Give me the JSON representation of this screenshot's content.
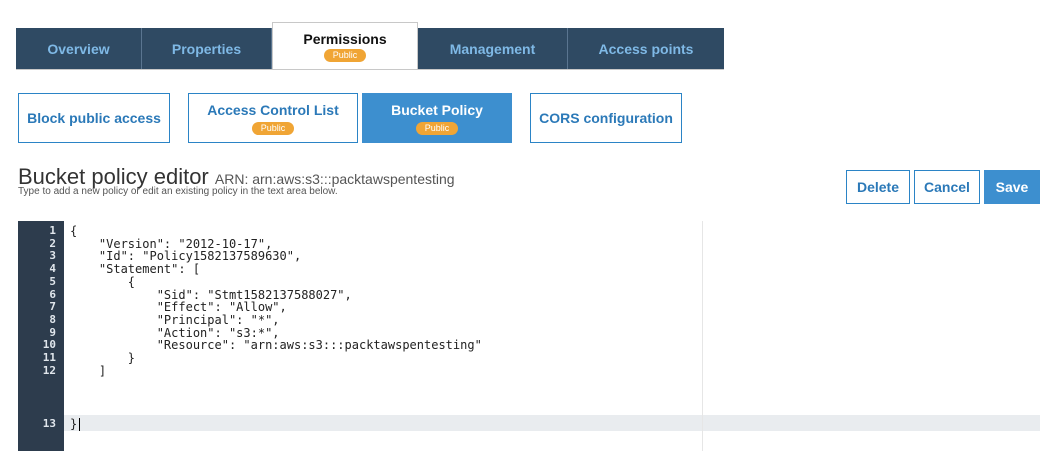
{
  "tabs": [
    {
      "label": "Overview",
      "badge": ""
    },
    {
      "label": "Properties",
      "badge": ""
    },
    {
      "label": "Permissions",
      "badge": "Public",
      "active": true
    },
    {
      "label": "Management",
      "badge": ""
    },
    {
      "label": "Access points",
      "badge": ""
    }
  ],
  "subtabs": [
    {
      "label": "Block public access",
      "badge": ""
    },
    {
      "label": "Access Control List",
      "badge": "Public"
    },
    {
      "label": "Bucket Policy",
      "badge": "Public",
      "active": true
    },
    {
      "label": "CORS configuration",
      "badge": ""
    }
  ],
  "editor_header": {
    "title": "Bucket policy editor",
    "arn": "ARN: arn:aws:s3:::packtawspentesting",
    "subtitle": "Type to add a new policy or edit an existing policy in the text area below."
  },
  "actions": {
    "delete": "Delete",
    "cancel": "Cancel",
    "save": "Save"
  },
  "colors": {
    "tab_bg": "#2f4a63",
    "tab_text": "#7fb9e6",
    "accent": "#3d8fcf",
    "badge": "#f0a535",
    "gutter": "#2d3c4d"
  },
  "code_lines": [
    {
      "num": "1",
      "text": "{"
    },
    {
      "num": "2",
      "text": "    \"Version\": \"2012-10-17\","
    },
    {
      "num": "3",
      "text": "    \"Id\": \"Policy1582137589630\","
    },
    {
      "num": "4",
      "text": "    \"Statement\": ["
    },
    {
      "num": "5",
      "text": "        {"
    },
    {
      "num": "6",
      "text": "            \"Sid\": \"Stmt1582137588027\","
    },
    {
      "num": "7",
      "text": "            \"Effect\": \"Allow\","
    },
    {
      "num": "8",
      "text": "            \"Principal\": \"*\","
    },
    {
      "num": "9",
      "text": "            \"Action\": \"s3:*\","
    },
    {
      "num": "10",
      "text": "            \"Resource\": \"arn:aws:s3:::packtawspentesting\""
    },
    {
      "num": "11",
      "text": "        }"
    },
    {
      "num": "12",
      "text": "    ]"
    },
    {
      "num": "13",
      "text": "}"
    }
  ]
}
